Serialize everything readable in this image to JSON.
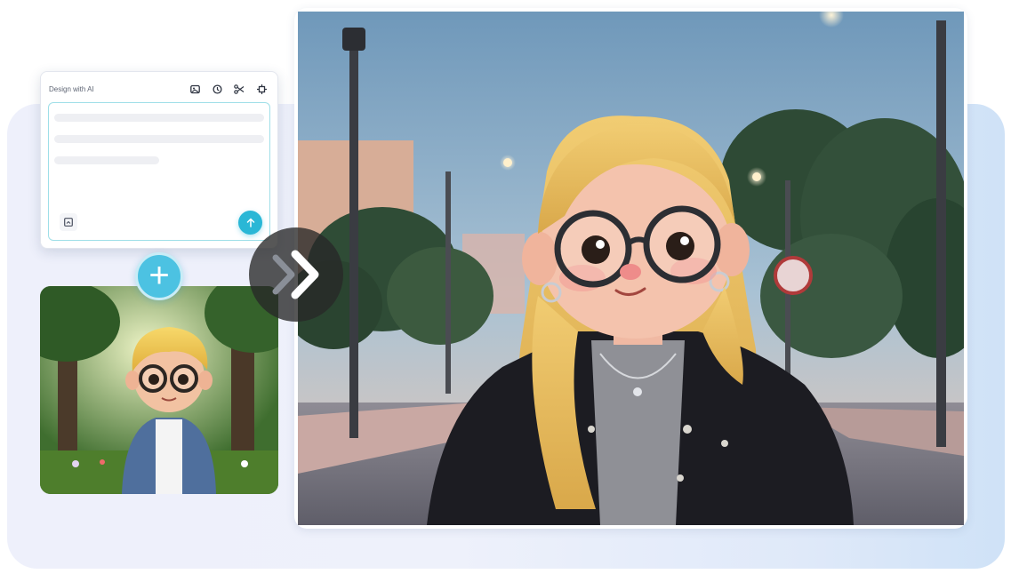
{
  "prompt_card": {
    "title": "Design with AI",
    "tools": [
      "image-icon",
      "history-icon",
      "scissors-icon",
      "crop-icon"
    ],
    "placeholder_lines": 3,
    "attach_icon": "image-upload-icon",
    "send_icon": "arrow-up-icon"
  },
  "plus_icon": "plus-icon",
  "arrow_icon": "double-chevron-right-icon",
  "colors": {
    "accent": "#2ab7d6",
    "plus": "#4cc2e2",
    "backdrop": "#e6ecfa"
  }
}
